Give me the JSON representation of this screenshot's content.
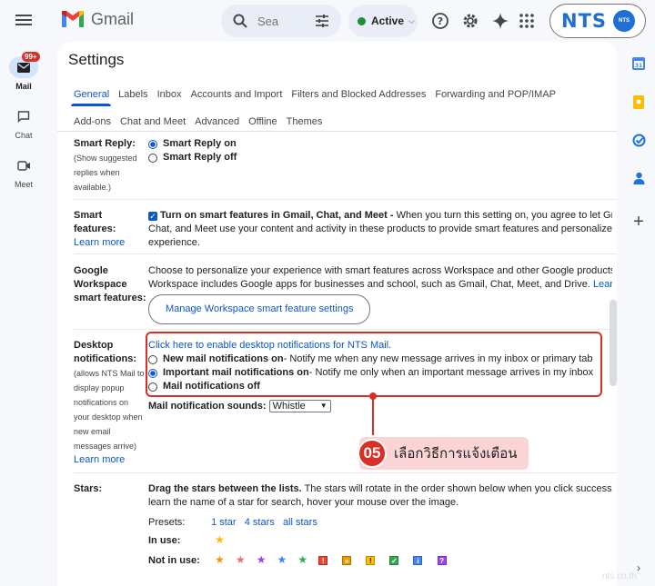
{
  "topbar": {
    "app_name": "Gmail",
    "search_placeholder": "Sea",
    "status_label": "Active",
    "status_color": "#1e8e3e",
    "account_badge_text": "NTS",
    "account_badge_small": "NTS"
  },
  "rail": {
    "items": [
      {
        "label": "Mail",
        "badge": "99+",
        "icon": "mail-icon"
      },
      {
        "label": "Chat",
        "icon": "chat-icon"
      },
      {
        "label": "Meet",
        "icon": "video-icon"
      }
    ]
  },
  "main": {
    "title": "Settings",
    "tabs_row1": [
      "General",
      "Labels",
      "Inbox",
      "Accounts and Import",
      "Filters and Blocked Addresses",
      "Forwarding and POP/IMAP"
    ],
    "tabs_row2": [
      "Add-ons",
      "Chat and Meet",
      "Advanced",
      "Offline",
      "Themes"
    ]
  },
  "smart_reply": {
    "label": "Smart Reply:",
    "sub": "(Show suggested replies when available.)",
    "on": "Smart Reply on",
    "off": "Smart Reply off"
  },
  "smart_features": {
    "label": "Smart features:",
    "learn_more": "Learn more",
    "checkbox_bold": "Turn on smart features in Gmail, Chat, and Meet -",
    "line1_rest": " When you turn this setting on, you agree to let Gm",
    "line2": "Chat, and Meet use your content and activity in these products to provide smart features and personalize y",
    "line3": "experience."
  },
  "workspace": {
    "label": "Google Workspace smart features:",
    "line1": "Choose to personalize your experience with smart features across Workspace and other Google products.",
    "line2": "Workspace includes Google apps for businesses and school, such as Gmail, Chat, Meet, and Drive.",
    "learn": "Learn m",
    "button": "Manage Workspace smart feature settings"
  },
  "desktop": {
    "label": "Desktop notifications:",
    "sub": "(allows NTS Mail to display popup notifications on your desktop when new email messages arrive)",
    "learn_more": "Learn more",
    "enable_link": "Click here to enable desktop notifications for NTS Mail.",
    "opt1_bold": "New mail notifications on",
    "opt1_rest": " - Notify me when any new message arrives in my inbox or primary tab",
    "opt2_bold": "Important mail notifications on",
    "opt2_rest": " - Notify me only when an important message arrives in my inbox",
    "opt3_bold": "Mail notifications off",
    "sound_label": "Mail notification sounds:",
    "sound_value": "Whistle"
  },
  "callout": {
    "number": "05",
    "text": "เลือกวิธีการแจ้งเตือน"
  },
  "stars": {
    "label": "Stars:",
    "drag_bold": "Drag the stars between the lists.",
    "drag_rest": "  The stars will rotate in the order shown below when you click successi",
    "line2": "learn the name of a star for search, hover your mouse over the image.",
    "presets_label": "Presets:",
    "preset1": "1 star",
    "preset2": "4 stars",
    "preset3": "all stars",
    "in_use": "In use:",
    "not_in_use": "Not in use:"
  },
  "watermark": "nts.co.th"
}
